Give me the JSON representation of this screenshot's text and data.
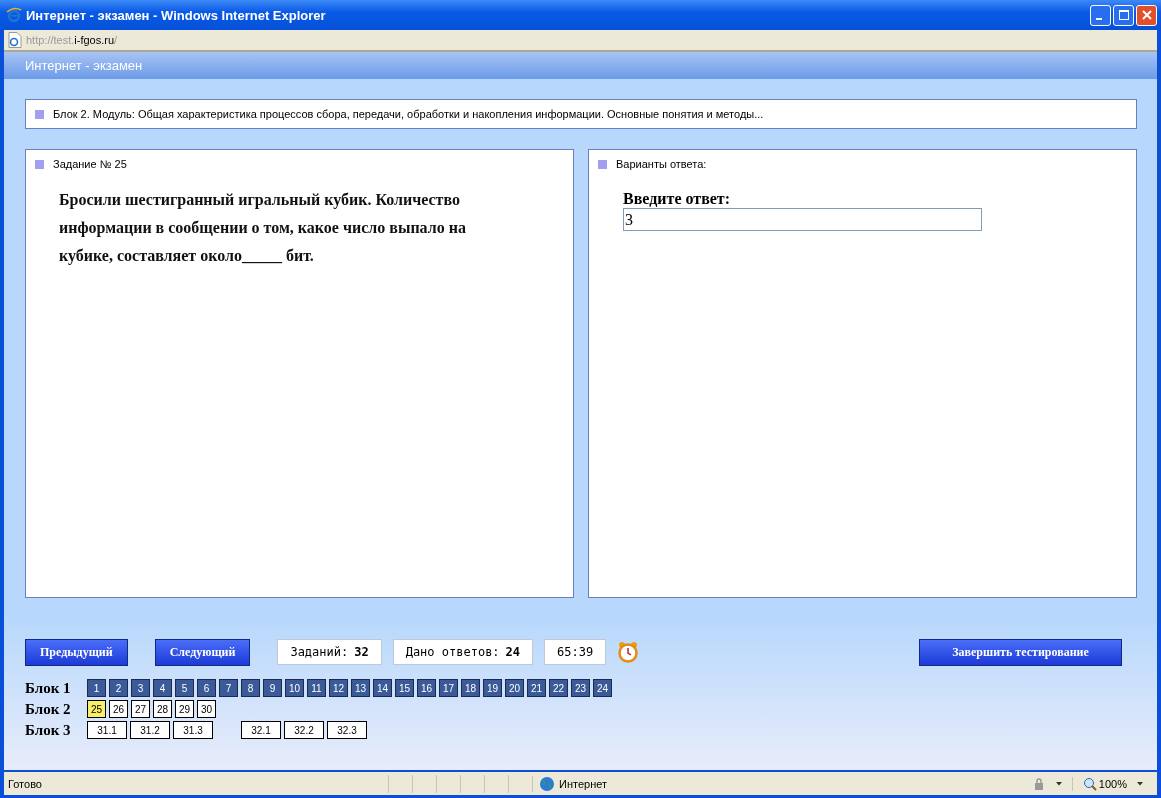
{
  "window": {
    "title": "Интернет - экзамен - Windows Internet Explorer"
  },
  "address": {
    "parts": [
      {
        "text": "http://test.",
        "kind": "dim"
      },
      {
        "text": "i-fgos.ru",
        "kind": "host"
      },
      {
        "text": "/",
        "kind": "dim"
      }
    ]
  },
  "app_header": {
    "title": "Интернет - экзамен"
  },
  "module": {
    "text": "Блок 2. Модуль: Общая характеристика процессов сбора, передачи, обработки и накопления информации. Основные понятия и методы..."
  },
  "task": {
    "heading": "Задание № 25",
    "text": "Бросили шестигранный игральный кубик. Количество информации в сообщении о том, какое число выпало на кубике, составляет около_____ бит."
  },
  "answer": {
    "heading": "Варианты ответа:",
    "label": "Введите ответ:",
    "value": "3"
  },
  "nav": {
    "prev": "Предыдущий",
    "next": "Следующий",
    "finish": "Завершить тестирование"
  },
  "counters": [
    {
      "label": "Заданий:",
      "value": "32"
    },
    {
      "label": "Дано ответов:",
      "value": "24"
    }
  ],
  "timer": "65:39",
  "blocks": [
    {
      "label": "Блок 1",
      "groups": [
        [
          {
            "n": "1",
            "answered": true,
            "selected": false
          },
          {
            "n": "2",
            "answered": true,
            "selected": false
          },
          {
            "n": "3",
            "answered": true,
            "selected": false
          },
          {
            "n": "4",
            "answered": true,
            "selected": false
          },
          {
            "n": "5",
            "answered": true,
            "selected": false
          },
          {
            "n": "6",
            "answered": true,
            "selected": false
          },
          {
            "n": "7",
            "answered": true,
            "selected": false
          },
          {
            "n": "8",
            "answered": true,
            "selected": false
          },
          {
            "n": "9",
            "answered": true,
            "selected": false
          },
          {
            "n": "10",
            "answered": true,
            "selected": false
          },
          {
            "n": "11",
            "answered": true,
            "selected": false
          },
          {
            "n": "12",
            "answered": true,
            "selected": false
          },
          {
            "n": "13",
            "answered": true,
            "selected": false
          },
          {
            "n": "14",
            "answered": true,
            "selected": false
          },
          {
            "n": "15",
            "answered": true,
            "selected": false
          },
          {
            "n": "16",
            "answered": true,
            "selected": false
          },
          {
            "n": "17",
            "answered": true,
            "selected": false
          },
          {
            "n": "18",
            "answered": true,
            "selected": false
          },
          {
            "n": "19",
            "answered": true,
            "selected": false
          },
          {
            "n": "20",
            "answered": true,
            "selected": false
          },
          {
            "n": "21",
            "answered": true,
            "selected": false
          },
          {
            "n": "22",
            "answered": true,
            "selected": false
          },
          {
            "n": "23",
            "answered": true,
            "selected": false
          },
          {
            "n": "24",
            "answered": true,
            "selected": false
          }
        ]
      ]
    },
    {
      "label": "Блок 2",
      "groups": [
        [
          {
            "n": "25",
            "answered": false,
            "selected": true
          },
          {
            "n": "26",
            "answered": false,
            "selected": false
          },
          {
            "n": "27",
            "answered": false,
            "selected": false
          },
          {
            "n": "28",
            "answered": false,
            "selected": false
          },
          {
            "n": "29",
            "answered": false,
            "selected": false
          },
          {
            "n": "30",
            "answered": false,
            "selected": false
          }
        ]
      ]
    },
    {
      "label": "Блок 3",
      "groups": [
        [
          {
            "n": "31.1",
            "answered": false,
            "selected": false
          },
          {
            "n": "31.2",
            "answered": false,
            "selected": false
          },
          {
            "n": "31.3",
            "answered": false,
            "selected": false
          }
        ],
        [
          {
            "n": "32.1",
            "answered": false,
            "selected": false
          },
          {
            "n": "32.2",
            "answered": false,
            "selected": false
          },
          {
            "n": "32.3",
            "answered": false,
            "selected": false
          }
        ]
      ]
    }
  ],
  "status_bar": {
    "text": "Готово",
    "zone": "Интернет",
    "zoom": "100%"
  }
}
